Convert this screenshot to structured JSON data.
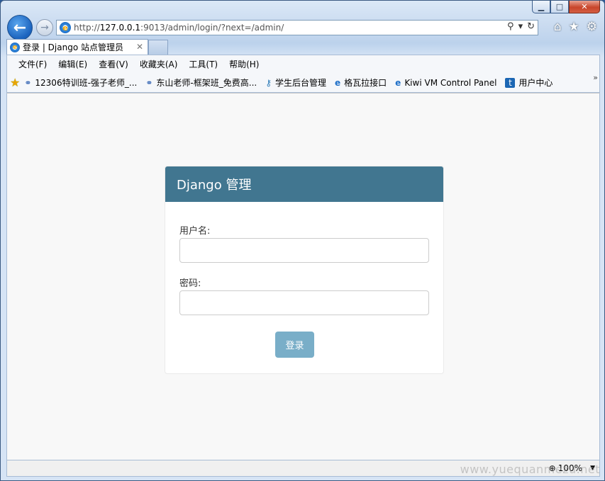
{
  "window": {
    "caption_minimize": "▁",
    "caption_maximize": "□",
    "caption_close": "✕"
  },
  "nav": {
    "back_glyph": "←",
    "forward_glyph": "→",
    "url_prefix": "http://",
    "url_host": "127.0.0.1",
    "url_rest": ":9013/admin/login/?next=/admin/",
    "search_glyph": "⚲",
    "dropdown_glyph": "▾",
    "refresh_glyph": "↻",
    "home_glyph": "⌂",
    "favorites_glyph": "★",
    "tools_glyph": "⚙"
  },
  "tab": {
    "title": "登录 | Django 站点管理员",
    "close_glyph": "✕"
  },
  "menubar": {
    "items": [
      "文件(F)",
      "编辑(E)",
      "查看(V)",
      "收藏夹(A)",
      "工具(T)",
      "帮助(H)"
    ]
  },
  "favorites": {
    "star_glyph": "★",
    "items": [
      {
        "label": "12306特训班-强子老师_...",
        "icon": "cluster-icon"
      },
      {
        "label": "东山老师-框架班_免费高...",
        "icon": "cluster-icon"
      },
      {
        "label": "学生后台管理",
        "icon": "key-icon"
      },
      {
        "label": "格瓦拉接口",
        "icon": "ie-page-icon"
      },
      {
        "label": "Kiwi VM Control Panel",
        "icon": "ie-page-icon"
      },
      {
        "label": "用户中心",
        "icon": "telecom-icon"
      }
    ],
    "overflow_glyph": "»"
  },
  "login": {
    "header": "Django 管理",
    "username_label": "用户名:",
    "username_value": "",
    "password_label": "密码:",
    "password_value": "",
    "submit_label": "登录"
  },
  "status": {
    "zoom": "100%",
    "zoom_glyph": "⊕",
    "caret_glyph": "▼"
  },
  "watermark": "www.yuequanmezu.net",
  "colors": {
    "header_bg": "#417690",
    "button_bg": "#79aec8",
    "content_bg": "#f8f8f8"
  }
}
